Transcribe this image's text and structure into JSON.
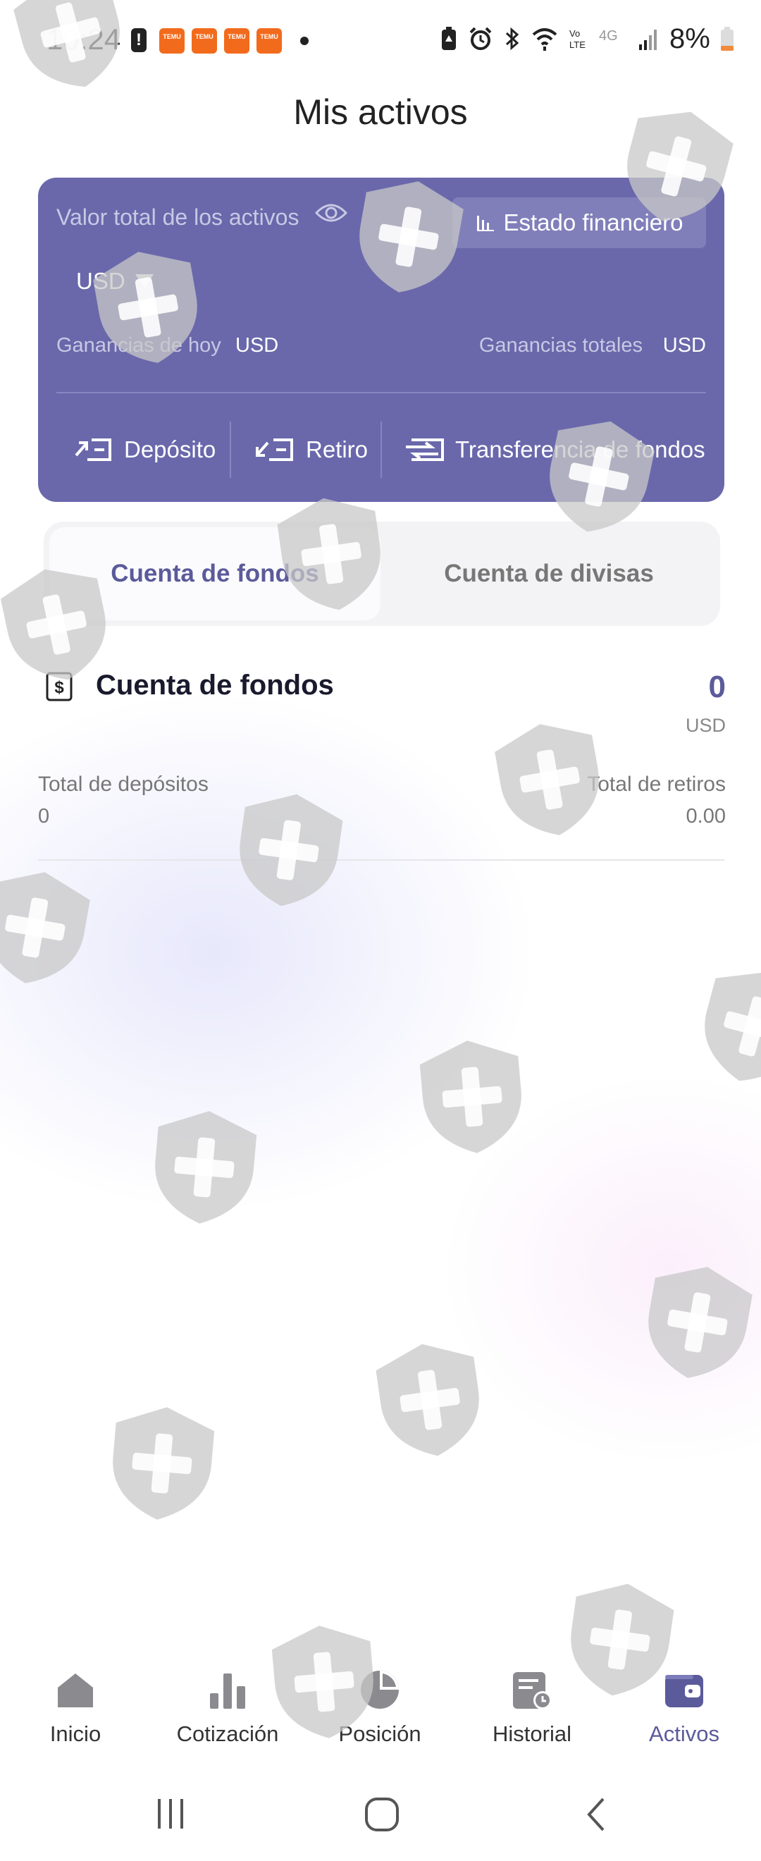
{
  "status_bar": {
    "time": "10:24",
    "alert_glyph": "!",
    "app_badges": [
      "TEMU",
      "TEMU",
      "TEMU",
      "TEMU"
    ],
    "battery_percent": "8%",
    "icons": [
      "battery-saver-icon",
      "alarm-icon",
      "bluetooth-icon",
      "wifi-icon",
      "volte-icon",
      "4g-icon",
      "signal-icon",
      "battery-icon"
    ]
  },
  "header": {
    "title": "Mis activos"
  },
  "assets_card": {
    "total_label": "Valor total de los activos",
    "statement_button": "Estado financiero",
    "currency": "USD",
    "gains_today_label": "Ganancias de hoy",
    "gains_today_currency": "USD",
    "gains_total_label": "Ganancias totales",
    "gains_total_currency": "USD",
    "actions": {
      "deposit": "Depósito",
      "withdraw": "Retiro",
      "transfer": "Transferencia de fondos"
    }
  },
  "tabs": [
    {
      "label": "Cuenta de fondos",
      "active": true
    },
    {
      "label": "Cuenta de divisas",
      "active": false
    }
  ],
  "account": {
    "title": "Cuenta de fondos",
    "value": "0",
    "currency": "USD",
    "total_deposits_label": "Total de depósitos",
    "total_deposits_value": "0",
    "total_withdrawals_label": "Total de retiros",
    "total_withdrawals_value": "0.00"
  },
  "bottom_nav": [
    {
      "label": "Inicio",
      "icon": "home-icon",
      "active": false
    },
    {
      "label": "Cotización",
      "icon": "bar-chart-icon",
      "active": false
    },
    {
      "label": "Posición",
      "icon": "pie-chart-icon",
      "active": false
    },
    {
      "label": "Historial",
      "icon": "history-icon",
      "active": false
    },
    {
      "label": "Activos",
      "icon": "wallet-icon",
      "active": true
    }
  ],
  "colors": {
    "card": "#6a68ab",
    "accent": "#5b5a9a",
    "nav_icon": "#8a8a8f",
    "watermark": "#c8c8c8"
  }
}
